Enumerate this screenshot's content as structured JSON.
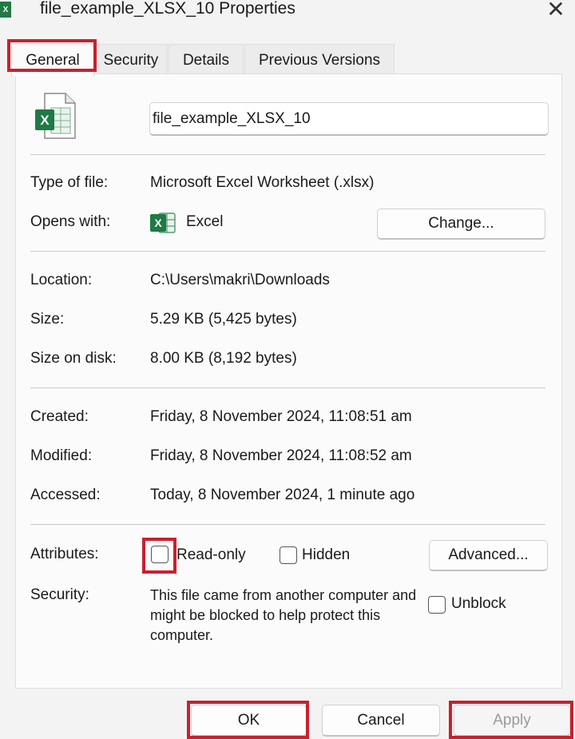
{
  "window": {
    "title": "file_example_XLSX_10 Properties",
    "app_icon": "excel-icon",
    "close_glyph": "✕"
  },
  "tabs": [
    {
      "label": "General",
      "active": true
    },
    {
      "label": "Security",
      "active": false
    },
    {
      "label": "Details",
      "active": false
    },
    {
      "label": "Previous Versions",
      "active": false
    }
  ],
  "file": {
    "name": "file_example_XLSX_10",
    "icon": "excel-file-icon"
  },
  "type": {
    "type_label": "Type of file:",
    "type_value": "Microsoft Excel Worksheet (.xlsx)",
    "opens_label": "Opens with:",
    "opens_value": "Excel",
    "change_button": "Change..."
  },
  "location": {
    "location_label": "Location:",
    "location_value": "C:\\Users\\makri\\Downloads",
    "size_label": "Size:",
    "size_value": "5.29 KB (5,425 bytes)",
    "size_on_disk_label": "Size on disk:",
    "size_on_disk_value": "8.00 KB (8,192 bytes)"
  },
  "dates": {
    "created_label": "Created:",
    "created_value": "Friday, 8 November 2024, 11:08:51 am",
    "modified_label": "Modified:",
    "modified_value": "Friday, 8 November 2024, 11:08:52 am",
    "accessed_label": "Accessed:",
    "accessed_value": "Today, 8 November 2024, 1 minute ago"
  },
  "attributes": {
    "label": "Attributes:",
    "readonly_label": "Read-only",
    "readonly_checked": false,
    "hidden_label": "Hidden",
    "hidden_checked": false,
    "advanced_button": "Advanced..."
  },
  "security": {
    "label": "Security:",
    "text": "This file came from another computer and might be blocked to help protect this computer.",
    "unblock_label": "Unblock",
    "unblock_checked": false
  },
  "footer": {
    "ok": "OK",
    "cancel": "Cancel",
    "apply": "Apply"
  },
  "colors": {
    "highlight": "#c8202f",
    "excel_green": "#1f7a44"
  }
}
